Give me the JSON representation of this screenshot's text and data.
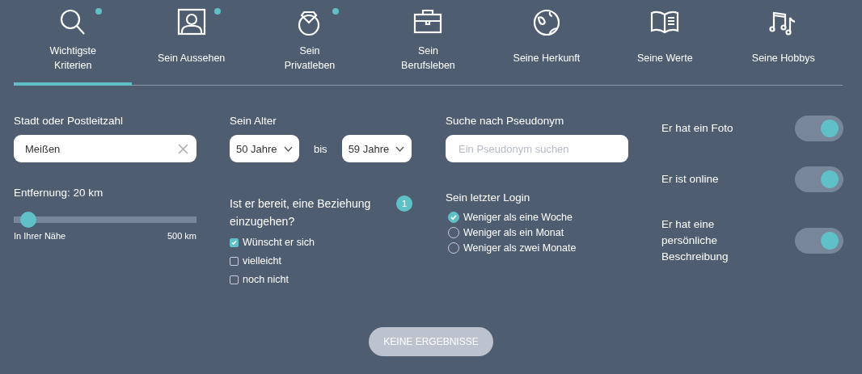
{
  "tabs": [
    {
      "label": "Wichtigste\nKriterien",
      "selected": true,
      "dot": true
    },
    {
      "label": "Sein Aussehen",
      "selected": false,
      "dot": true
    },
    {
      "label": "Sein\nPrivatleben",
      "selected": false,
      "dot": true
    },
    {
      "label": "Sein\nBerufsleben",
      "selected": false,
      "dot": false
    },
    {
      "label": "Seine Herkunft",
      "selected": false,
      "dot": false
    },
    {
      "label": "Seine Werte",
      "selected": false,
      "dot": false
    },
    {
      "label": "Seine Hobbys",
      "selected": false,
      "dot": false
    }
  ],
  "location": {
    "label": "Stadt oder Postleitzahl",
    "value": "Meißen"
  },
  "distance": {
    "label": "Entfernung: 20 km",
    "level": 0.04,
    "min_label": "In Ihrer Nähe",
    "max_label": "500 km"
  },
  "age": {
    "label": "Sein Alter",
    "from": "50 Jahre",
    "separator": "bis",
    "to": "59 Jahre"
  },
  "relationship": {
    "label": "Ist er bereit, eine Beziehung einzugehen?",
    "badge": "1",
    "options": [
      {
        "label": "Wünscht er sich",
        "checked": true
      },
      {
        "label": "vielleicht",
        "checked": false
      },
      {
        "label": "noch nicht",
        "checked": false
      }
    ]
  },
  "pseudonym": {
    "label": "Suche nach Pseudonym",
    "placeholder": "Ein Pseudonym suchen"
  },
  "last_login": {
    "label": "Sein letzter Login",
    "options": [
      {
        "label": "Weniger als eine Woche",
        "selected": true
      },
      {
        "label": "Weniger als ein Monat",
        "selected": false
      },
      {
        "label": "Weniger als zwei Monate",
        "selected": false
      }
    ]
  },
  "toggles": [
    {
      "label": "Er hat ein Foto",
      "on": true
    },
    {
      "label": "Er ist online",
      "on": true
    },
    {
      "label": "Er hat eine persönliche Beschreibung",
      "on": true
    }
  ],
  "submit": {
    "label": "KEINE ERGEBNISSE",
    "disabled": true
  }
}
